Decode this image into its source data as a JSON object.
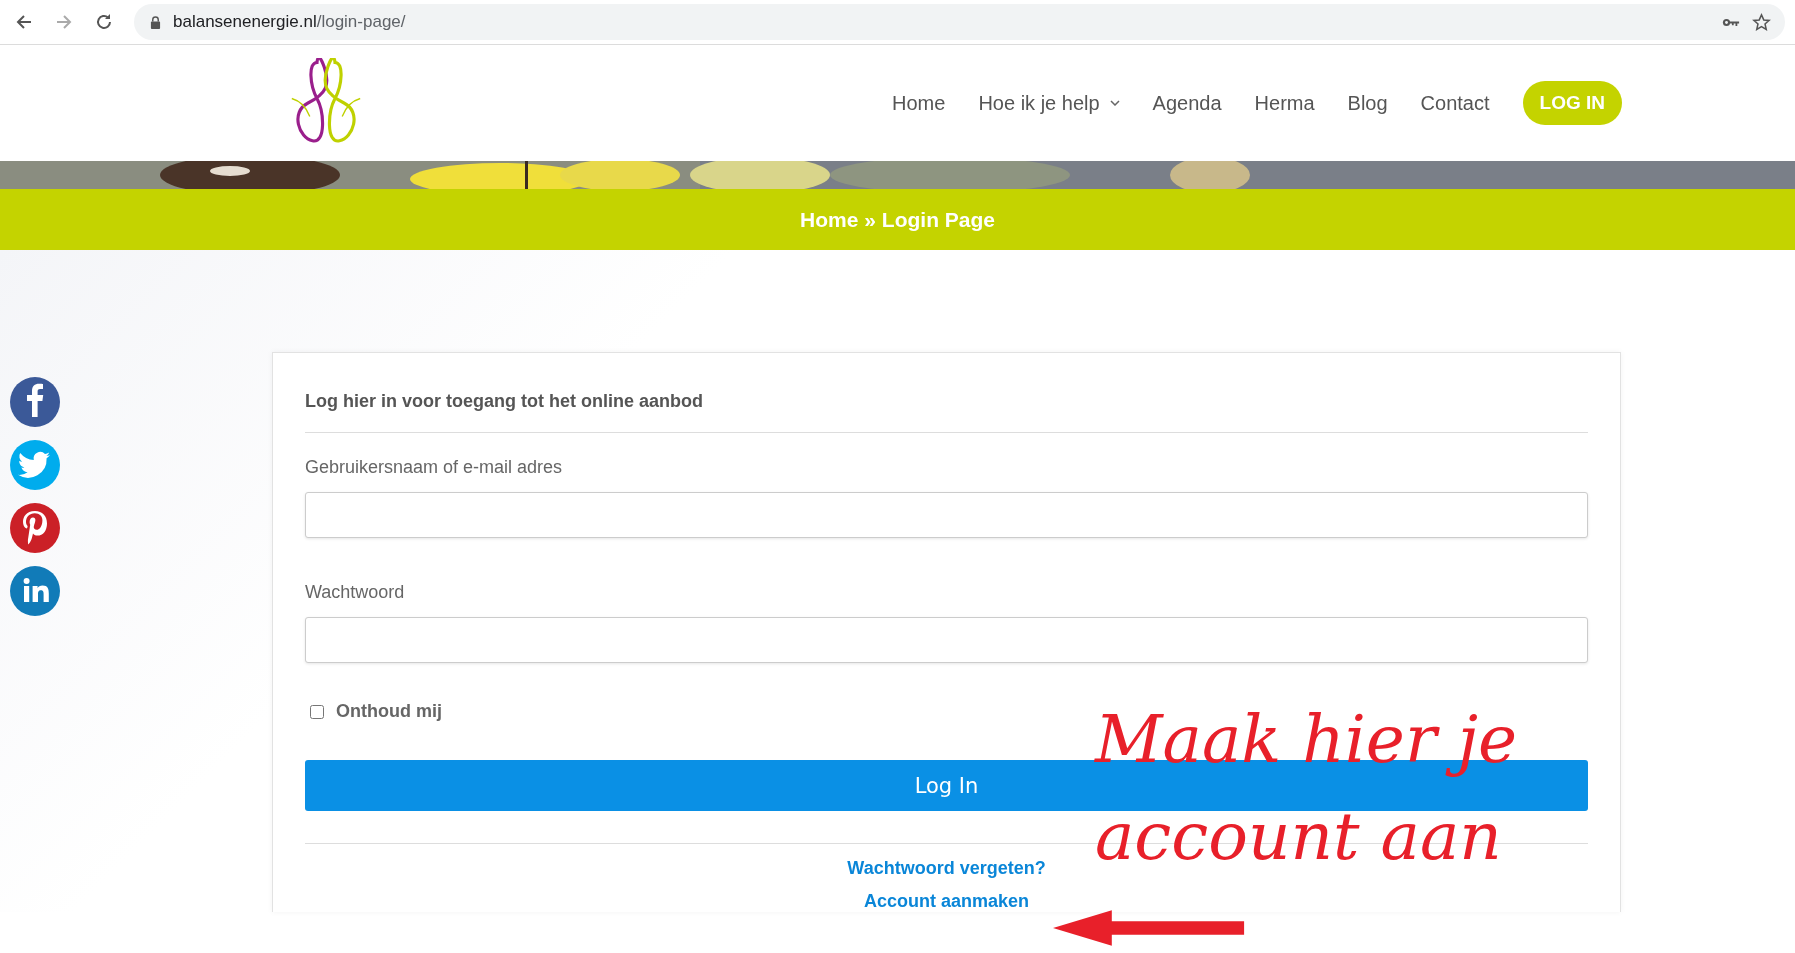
{
  "browser": {
    "url_domain": "balansenenergie.nl",
    "url_path": "/login-page/"
  },
  "nav": {
    "items": [
      {
        "label": "Home",
        "dropdown": false
      },
      {
        "label": "Hoe ik je help",
        "dropdown": true
      },
      {
        "label": "Agenda",
        "dropdown": false
      },
      {
        "label": "Herma",
        "dropdown": false
      },
      {
        "label": "Blog",
        "dropdown": false
      },
      {
        "label": "Contact",
        "dropdown": false
      }
    ],
    "login_button": "LOG IN"
  },
  "breadcrumb": {
    "home": "Home",
    "current": "» Login Page"
  },
  "social": [
    {
      "kind": "facebook",
      "color": "#3b5998"
    },
    {
      "kind": "twitter",
      "color": "#00aced"
    },
    {
      "kind": "pinterest",
      "color": "#cb2027"
    },
    {
      "kind": "linkedin",
      "color": "#117bb8"
    }
  ],
  "form": {
    "title": "Log hier in voor toegang tot het online aanbod",
    "fields": [
      {
        "label": "Gebruikersnaam of e-mail adres"
      },
      {
        "label": "Wachtwoord"
      }
    ],
    "remember": {
      "label": "Onthoud mij",
      "checked": false
    },
    "submit": "Log In",
    "links": [
      "Wachtwoord vergeten?",
      "Account aanmaken"
    ]
  },
  "annotation": {
    "lines": [
      "Maak hier je",
      "account aan"
    ]
  }
}
